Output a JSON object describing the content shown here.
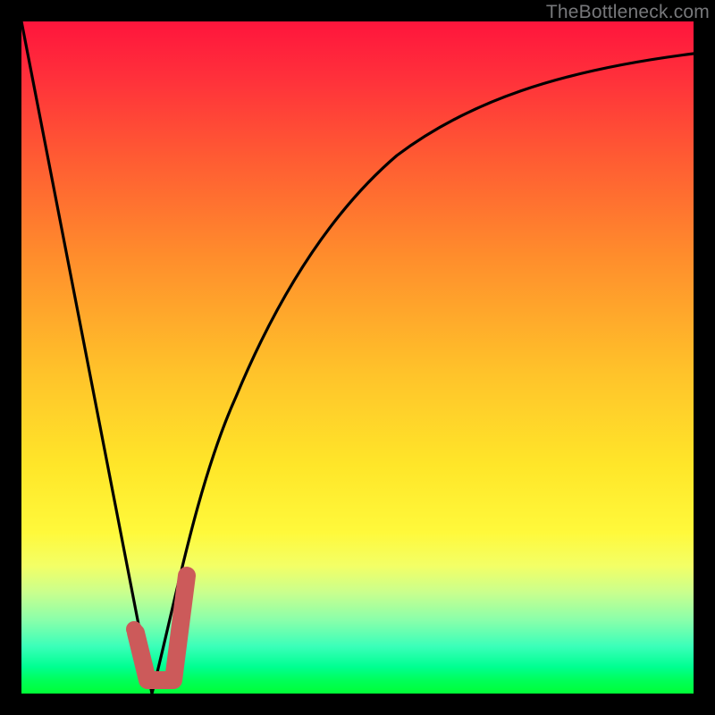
{
  "watermark": "TheBottleneck.com",
  "colors": {
    "frame": "#000000",
    "marker": "#cc5a5a",
    "curve": "#000000",
    "gradient_top": "#ff153c",
    "gradient_bottom": "#00ff36"
  },
  "chart_data": {
    "type": "line",
    "title": "",
    "xlabel": "",
    "ylabel": "",
    "xlim": [
      0,
      100
    ],
    "ylim": [
      0,
      100
    ],
    "grid": false,
    "series": [
      {
        "name": "bottleneck-curve",
        "x": [
          0,
          5,
          10,
          15,
          18,
          19.5,
          21,
          23,
          26,
          30,
          35,
          40,
          45,
          50,
          55,
          60,
          65,
          70,
          75,
          80,
          85,
          90,
          95,
          100
        ],
        "y": [
          100,
          74,
          48,
          22,
          6,
          0,
          3,
          12,
          26,
          42,
          56,
          66,
          74,
          79,
          83,
          86,
          88.5,
          90.3,
          91.7,
          92.8,
          93.6,
          94.3,
          94.8,
          95.2
        ]
      }
    ],
    "annotations": [
      {
        "name": "check-mark",
        "type": "polyline",
        "points_xy": [
          [
            17.0,
            9.0
          ],
          [
            18.8,
            2.0
          ],
          [
            22.6,
            2.0
          ],
          [
            24.6,
            17.5
          ]
        ]
      },
      {
        "name": "dot",
        "type": "point",
        "x": 16.8,
        "y": 9.5
      }
    ],
    "description": "V-shaped bottleneck curve over red→yellow→green vertical gradient. Minimum near x≈19.5 at y=0. Right branch asymptotes toward ~95. Salmon check-mark marker and dot near the minimum."
  }
}
